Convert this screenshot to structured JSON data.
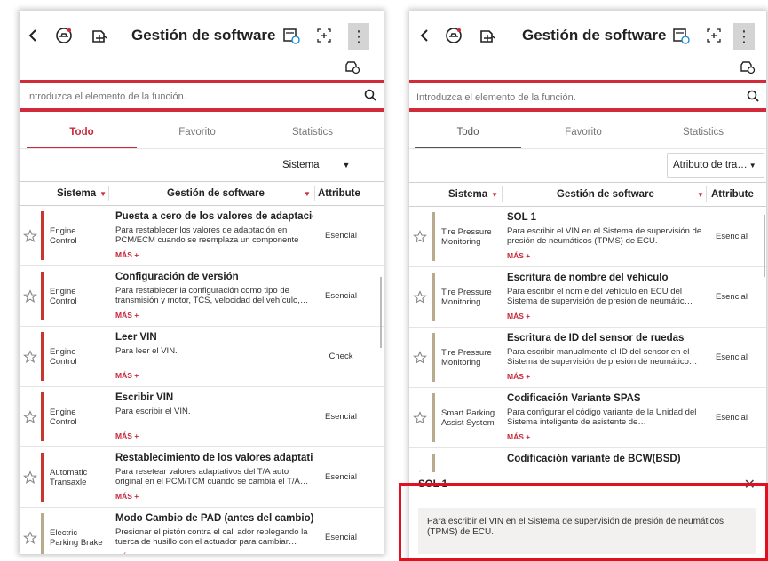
{
  "left": {
    "title": "Gestión de software",
    "search_placeholder": "Introduzca el elemento de la función.",
    "tabs": [
      "Todo",
      "Favorito",
      "Statistics"
    ],
    "dropdown": "Sistema",
    "columns": {
      "system": "Sistema",
      "software": "Gestión de software",
      "attribute": "Attribute"
    },
    "more_label": "MÁS +",
    "rows": [
      {
        "system": "Engine\nControl",
        "title": "Puesta a cero de los valores de adaptación",
        "desc": "Para restablecer los valores de adaptación en PCM/ECM cuando se reemplaza un componente",
        "attr": "Esencial",
        "bar": "#c8372d"
      },
      {
        "system": "Engine\nControl",
        "title": "Configuración de versión",
        "desc": "Para restablecer la configuración como tipo de transmisión y motor, TCS, velocidad del vehículo,…",
        "attr": "Esencial",
        "bar": "#c8372d"
      },
      {
        "system": "Engine\nControl",
        "title": "Leer VIN",
        "desc": "Para leer el VIN.",
        "attr": "Check",
        "bar": "#c8372d"
      },
      {
        "system": "Engine\nControl",
        "title": "Escribir VIN",
        "desc": "Para escribir el VIN.",
        "attr": "Esencial",
        "bar": "#c8372d"
      },
      {
        "system": "Automatic\nTransaxle",
        "title": "Restablecimiento de los valores adaptati…",
        "desc": "Para resetear valores adaptativos del T/A auto original en el PCM/TCM cuando se cambia el T/A…",
        "attr": "Esencial",
        "bar": "#c8372d"
      },
      {
        "system": "Electric\nParking Brake",
        "title": "Modo Cambio de PAD (antes del cambio)",
        "desc": "Presionar el pistón contra el cali ador replegando la tuerca de husillo con el actuador para cambiar…",
        "attr": "Esencial",
        "bar": "#b7aa8d"
      }
    ]
  },
  "right": {
    "title": "Gestión de software",
    "search_placeholder": "Introduzca el elemento de la función.",
    "tabs": [
      "Todo",
      "Favorito",
      "Statistics"
    ],
    "dropdown": "Atributo de tra…",
    "columns": {
      "system": "Sistema",
      "software": "Gestión de software",
      "attribute": "Attribute"
    },
    "more_label": "MÁS +",
    "rows": [
      {
        "system": "Tire Pressure\nMonitoring",
        "title": "SOL 1",
        "desc": "Para escribir el VIN en el Sistema de supervisión de presión de neumáticos (TPMS) de ECU.",
        "attr": "Esencial",
        "bar": "#b7aa8d"
      },
      {
        "system": "Tire Pressure\nMonitoring",
        "title": "Escritura de nombre del vehículo",
        "desc": "Para escribir el nom e del vehículo en ECU del Sistema de supervisión de presión de neumátic…",
        "attr": "Esencial",
        "bar": "#b7aa8d"
      },
      {
        "system": "Tire Pressure\nMonitoring",
        "title": "Escritura de ID del sensor de ruedas",
        "desc": "Para escribir manualmente el ID del sensor en el Sistema de supervisión de presión de neumático…",
        "attr": "Esencial",
        "bar": "#b7aa8d"
      },
      {
        "system": "Smart Parking\nAssist System",
        "title": "Codificación Variante SPAS",
        "desc": "Para configurar el código variante de la Unidad del Sistema inteligente de asistente de…",
        "attr": "Esencial",
        "bar": "#b7aa8d"
      },
      {
        "system": "",
        "title": "Codificación variante de BCW(BSD)",
        "desc": "",
        "attr": "",
        "bar": "#b7aa8d"
      }
    ],
    "popup": {
      "title": "SOL 1",
      "text": "Para escribir el VIN en el Sistema de supervisión de presión de neumáticos (TPMS) de ECU."
    }
  },
  "colors": {
    "accent": "#c8283a",
    "highlight": "#e01020"
  },
  "icons": [
    "back-arrow-icon",
    "vehicle-scan-icon",
    "vehicle-upload-icon",
    "vehicle-badge-icon",
    "expand-icon",
    "more-vertical-icon",
    "vehicle-settings-icon",
    "search-icon",
    "star-icon",
    "close-icon"
  ]
}
